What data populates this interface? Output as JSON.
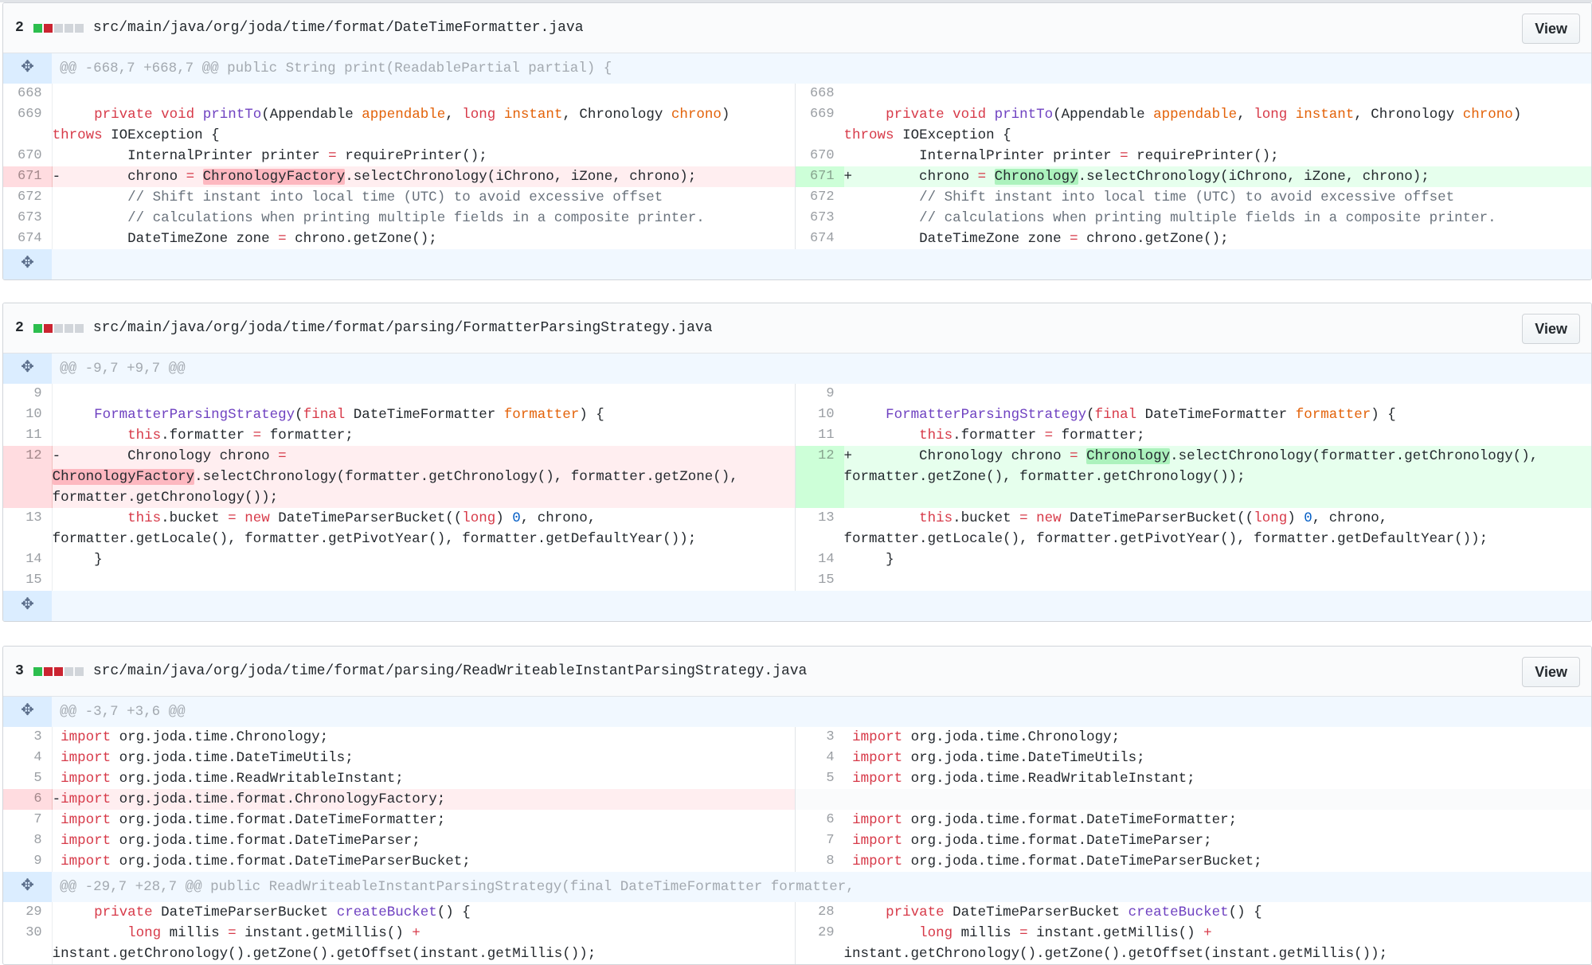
{
  "files": [
    {
      "count": "2",
      "bars": [
        "g",
        "r",
        "n",
        "n",
        "n"
      ],
      "path": "src/main/java/org/joda/time/format/DateTimeFormatter.java",
      "view_label": "View",
      "hunks": [
        {
          "header": "@@ -668,7 +668,7 @@ public String print(ReadablePartial partial) {",
          "rows": [
            {
              "l": {
                "n": "668",
                "t": "ctx",
                "h": ""
              },
              "r": {
                "n": "668",
                "t": "ctx",
                "h": ""
              }
            },
            {
              "l": {
                "n": "669",
                "t": "ctx",
                "h": "     <span class=\"k\">private</span> <span class=\"k\">void</span> <span class=\"f\">printTo</span>(Appendable <span class=\"v\">appendable</span>, <span class=\"k\">long</span> <span class=\"v\">instant</span>, Chronology <span class=\"v\">chrono</span>)\n<span class=\"k\">throws</span> IOException {"
              },
              "r": {
                "n": "669",
                "t": "ctx",
                "h": "     <span class=\"k\">private</span> <span class=\"k\">void</span> <span class=\"f\">printTo</span>(Appendable <span class=\"v\">appendable</span>, <span class=\"k\">long</span> <span class=\"v\">instant</span>, Chronology <span class=\"v\">chrono</span>)\n<span class=\"k\">throws</span> IOException {"
              }
            },
            {
              "l": {
                "n": "670",
                "t": "ctx",
                "h": "         InternalPrinter printer <span class=\"k\">=</span> requirePrinter();"
              },
              "r": {
                "n": "670",
                "t": "ctx",
                "h": "         InternalPrinter printer <span class=\"k\">=</span> requirePrinter();"
              }
            },
            {
              "l": {
                "n": "671",
                "t": "del",
                "h": "-        chrono <span class=\"k\">=</span> <span class=\"x\">ChronologyFactory</span>.selectChronology(iChrono, iZone, chrono);"
              },
              "r": {
                "n": "671",
                "t": "add",
                "h": "+        chrono <span class=\"k\">=</span> <span class=\"y\">Chronology</span>.selectChronology(iChrono, iZone, chrono);"
              }
            },
            {
              "l": {
                "n": "672",
                "t": "ctx",
                "h": "         <span class=\"cm\">// Shift instant into local time (UTC) to avoid excessive offset</span>"
              },
              "r": {
                "n": "672",
                "t": "ctx",
                "h": "         <span class=\"cm\">// Shift instant into local time (UTC) to avoid excessive offset</span>"
              }
            },
            {
              "l": {
                "n": "673",
                "t": "ctx",
                "h": "         <span class=\"cm\">// calculations when printing multiple fields in a composite printer.</span>"
              },
              "r": {
                "n": "673",
                "t": "ctx",
                "h": "         <span class=\"cm\">// calculations when printing multiple fields in a composite printer.</span>"
              }
            },
            {
              "l": {
                "n": "674",
                "t": "ctx",
                "h": "         DateTimeZone zone <span class=\"k\">=</span> chrono.getZone();"
              },
              "r": {
                "n": "674",
                "t": "ctx",
                "h": "         DateTimeZone zone <span class=\"k\">=</span> chrono.getZone();"
              }
            }
          ]
        },
        {
          "header": "",
          "rows": []
        }
      ]
    },
    {
      "count": "2",
      "bars": [
        "g",
        "r",
        "n",
        "n",
        "n"
      ],
      "path": "src/main/java/org/joda/time/format/parsing/FormatterParsingStrategy.java",
      "view_label": "View",
      "hunks": [
        {
          "header": "@@ -9,7 +9,7 @@",
          "rows": [
            {
              "l": {
                "n": "9",
                "t": "ctx",
                "h": ""
              },
              "r": {
                "n": "9",
                "t": "ctx",
                "h": ""
              }
            },
            {
              "l": {
                "n": "10",
                "t": "ctx",
                "h": "     <span class=\"f\">FormatterParsingStrategy</span>(<span class=\"k\">final</span> DateTimeFormatter <span class=\"v\">formatter</span>) {"
              },
              "r": {
                "n": "10",
                "t": "ctx",
                "h": "     <span class=\"f\">FormatterParsingStrategy</span>(<span class=\"k\">final</span> DateTimeFormatter <span class=\"v\">formatter</span>) {"
              }
            },
            {
              "l": {
                "n": "11",
                "t": "ctx",
                "h": "         <span class=\"k\">this</span>.formatter <span class=\"k\">=</span> formatter;"
              },
              "r": {
                "n": "11",
                "t": "ctx",
                "h": "         <span class=\"k\">this</span>.formatter <span class=\"k\">=</span> formatter;"
              }
            },
            {
              "l": {
                "n": "12",
                "t": "del",
                "h": "-        Chronology chrono <span class=\"k\">=</span>\n<span class=\"x\">ChronologyFactory</span>.selectChronology(formatter.getChronology(), formatter.getZone(),\nformatter.getChronology());"
              },
              "r": {
                "n": "12",
                "t": "add",
                "h": "+        Chronology chrono <span class=\"k\">=</span> <span class=\"y\">Chronology</span>.selectChronology(formatter.getChronology(),\nformatter.getZone(), formatter.getChronology());"
              }
            },
            {
              "l": {
                "n": "13",
                "t": "ctx",
                "h": "         <span class=\"k\">this</span>.bucket <span class=\"k\">=</span> <span class=\"k\">new</span> DateTimeParserBucket((<span class=\"k\">long</span>) <span class=\"nm\">0</span>, chrono,\nformatter.getLocale(), formatter.getPivotYear(), formatter.getDefaultYear());"
              },
              "r": {
                "n": "13",
                "t": "ctx",
                "h": "         <span class=\"k\">this</span>.bucket <span class=\"k\">=</span> <span class=\"k\">new</span> DateTimeParserBucket((<span class=\"k\">long</span>) <span class=\"nm\">0</span>, chrono,\nformatter.getLocale(), formatter.getPivotYear(), formatter.getDefaultYear());"
              }
            },
            {
              "l": {
                "n": "14",
                "t": "ctx",
                "h": "     }"
              },
              "r": {
                "n": "14",
                "t": "ctx",
                "h": "     }"
              }
            },
            {
              "l": {
                "n": "15",
                "t": "ctx",
                "h": ""
              },
              "r": {
                "n": "15",
                "t": "ctx",
                "h": ""
              }
            }
          ]
        },
        {
          "header": "",
          "rows": []
        }
      ]
    },
    {
      "count": "3",
      "bars": [
        "g",
        "r",
        "r",
        "n",
        "n"
      ],
      "path": "src/main/java/org/joda/time/format/parsing/ReadWriteableInstantParsingStrategy.java",
      "view_label": "View",
      "hunks": [
        {
          "header": "@@ -3,7 +3,6 @@",
          "rows": [
            {
              "l": {
                "n": "3",
                "t": "ctx",
                "h": " <span class=\"k\">import</span> org.joda.time.Chronology;"
              },
              "r": {
                "n": "3",
                "t": "ctx",
                "h": " <span class=\"k\">import</span> org.joda.time.Chronology;"
              }
            },
            {
              "l": {
                "n": "4",
                "t": "ctx",
                "h": " <span class=\"k\">import</span> org.joda.time.DateTimeUtils;"
              },
              "r": {
                "n": "4",
                "t": "ctx",
                "h": " <span class=\"k\">import</span> org.joda.time.DateTimeUtils;"
              }
            },
            {
              "l": {
                "n": "5",
                "t": "ctx",
                "h": " <span class=\"k\">import</span> org.joda.time.ReadWritableInstant;"
              },
              "r": {
                "n": "5",
                "t": "ctx",
                "h": " <span class=\"k\">import</span> org.joda.time.ReadWritableInstant;"
              }
            },
            {
              "l": {
                "n": "6",
                "t": "del",
                "h": "-<span class=\"k\">import</span> org.joda.time.format.ChronologyFactory;"
              },
              "r": {
                "n": "",
                "t": "empty",
                "h": ""
              }
            },
            {
              "l": {
                "n": "7",
                "t": "ctx",
                "h": " <span class=\"k\">import</span> org.joda.time.format.DateTimeFormatter;"
              },
              "r": {
                "n": "6",
                "t": "ctx",
                "h": " <span class=\"k\">import</span> org.joda.time.format.DateTimeFormatter;"
              }
            },
            {
              "l": {
                "n": "8",
                "t": "ctx",
                "h": " <span class=\"k\">import</span> org.joda.time.format.DateTimeParser;"
              },
              "r": {
                "n": "7",
                "t": "ctx",
                "h": " <span class=\"k\">import</span> org.joda.time.format.DateTimeParser;"
              }
            },
            {
              "l": {
                "n": "9",
                "t": "ctx",
                "h": " <span class=\"k\">import</span> org.joda.time.format.DateTimeParserBucket;"
              },
              "r": {
                "n": "8",
                "t": "ctx",
                "h": " <span class=\"k\">import</span> org.joda.time.format.DateTimeParserBucket;"
              }
            }
          ]
        },
        {
          "header": "@@ -29,7 +28,7 @@ public ReadWriteableInstantParsingStrategy(final DateTimeFormatter formatter,",
          "rows": [
            {
              "l": {
                "n": "29",
                "t": "ctx",
                "h": "     <span class=\"k\">private</span> DateTimeParserBucket <span class=\"f\">createBucket</span>() {"
              },
              "r": {
                "n": "28",
                "t": "ctx",
                "h": "     <span class=\"k\">private</span> DateTimeParserBucket <span class=\"f\">createBucket</span>() {"
              }
            },
            {
              "l": {
                "n": "30",
                "t": "ctx",
                "h": "         <span class=\"k\">long</span> millis <span class=\"k\">=</span> instant.getMillis() <span class=\"k\">+</span>\ninstant.getChronology().getZone().getOffset(instant.getMillis());"
              },
              "r": {
                "n": "29",
                "t": "ctx",
                "h": "         <span class=\"k\">long</span> millis <span class=\"k\">=</span> instant.getMillis() <span class=\"k\">+</span>\ninstant.getChronology().getZone().getOffset(instant.getMillis());"
              }
            }
          ]
        }
      ]
    }
  ]
}
